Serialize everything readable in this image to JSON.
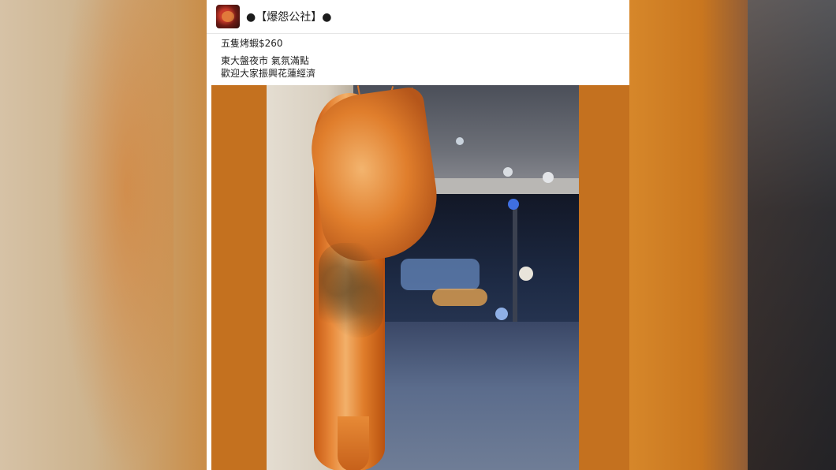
{
  "post": {
    "page_name": "●【爆怨公社】●",
    "text_line1": "五隻烤蝦$260",
    "text_line2": "東大盤夜市 氣氛滿點",
    "text_line3": "歡迎大家振興花蓮經濟"
  },
  "icons": {
    "avatar": "page-avatar-icon"
  },
  "colors": {
    "photo_frame": "#c4711f",
    "card_background": "#ffffff"
  }
}
